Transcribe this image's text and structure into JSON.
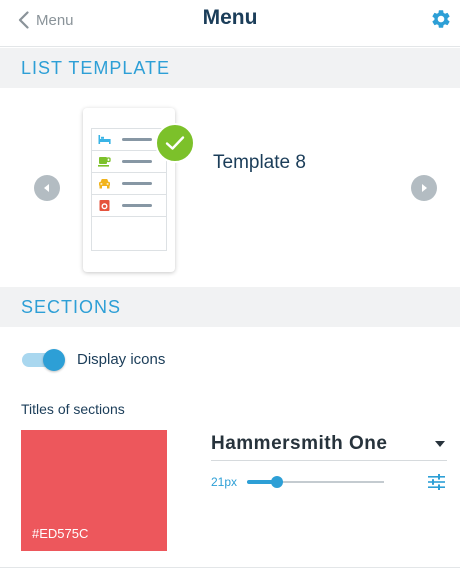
{
  "header": {
    "back_label": "Menu",
    "title": "Menu",
    "icon": "gear-icon"
  },
  "list_template": {
    "heading": "LIST TEMPLATE",
    "selected_template": "Template 8",
    "preview_icons": [
      "bed-icon",
      "coffee-cup-icon",
      "car-icon",
      "washer-icon"
    ]
  },
  "sections": {
    "heading": "SECTIONS",
    "display_icons": {
      "label": "Display icons",
      "enabled": true
    },
    "titles": {
      "label": "Titles of sections",
      "color_hex": "#ED575C",
      "font_name": "Hammersmith One",
      "font_size": "21px",
      "size_slider_fraction": 0.22
    }
  },
  "colors": {
    "accent": "#2d9fd6",
    "navy": "#1b3d59",
    "check_green": "#7cc12a",
    "title_color": "#ED575C"
  }
}
